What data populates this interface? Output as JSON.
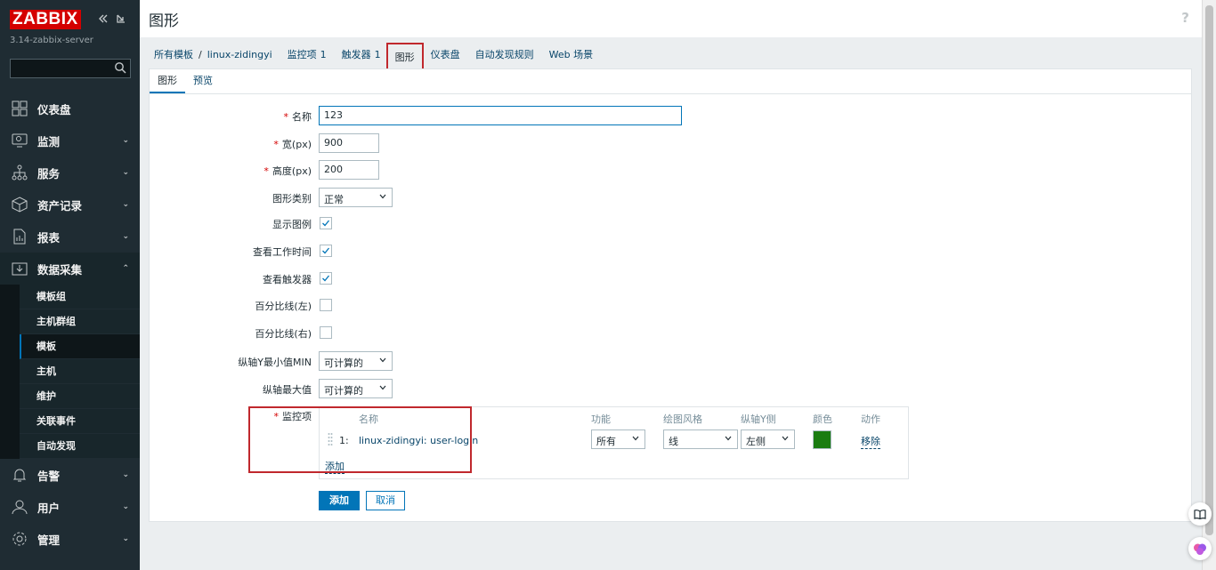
{
  "sidebar": {
    "logo": "ZABBIX",
    "server": "3.14-zabbix-server",
    "menu": [
      {
        "label": "仪表盘",
        "icon": "dashboard-icon"
      },
      {
        "label": "监测",
        "icon": "monitoring-icon"
      },
      {
        "label": "服务",
        "icon": "services-icon"
      },
      {
        "label": "资产记录",
        "icon": "inventory-icon"
      },
      {
        "label": "报表",
        "icon": "reports-icon"
      },
      {
        "label": "数据采集",
        "icon": "data-collection-icon"
      },
      {
        "label": "告警",
        "icon": "alerts-icon"
      },
      {
        "label": "用户",
        "icon": "users-icon"
      },
      {
        "label": "管理",
        "icon": "administration-icon"
      }
    ],
    "submenu": [
      "模板组",
      "主机群组",
      "模板",
      "主机",
      "维护",
      "关联事件",
      "自动发现"
    ]
  },
  "header": {
    "title": "图形",
    "help": "?"
  },
  "breadcrumb": {
    "all_templates": "所有模板",
    "separator": "/",
    "host": "linux-zidingyi",
    "items": "监控项",
    "items_count": "1",
    "triggers": "触发器",
    "triggers_count": "1",
    "graphs": "图形",
    "dashboards": "仪表盘",
    "discovery": "自动发现规则",
    "web": "Web 场景"
  },
  "tabs": {
    "graph": "图形",
    "preview": "预览"
  },
  "form": {
    "name_label": "名称",
    "name_value": "123",
    "width_label": "宽(px)",
    "width_value": "900",
    "height_label": "高度(px)",
    "height_value": "200",
    "type_label": "图形类别",
    "type_value": "正常",
    "legend_label": "显示图例",
    "legend_checked": true,
    "worktime_label": "查看工作时间",
    "worktime_checked": true,
    "triggers_label": "查看触发器",
    "triggers_checked": true,
    "percentile_left_label": "百分比线(左)",
    "percentile_left_checked": false,
    "percentile_right_label": "百分比线(右)",
    "percentile_right_checked": false,
    "ymin_label": "纵轴Y最小值MIN",
    "ymin_value": "可计算的",
    "ymax_label": "纵轴最大值",
    "ymax_value": "可计算的",
    "items_label": "监控项"
  },
  "items_table": {
    "headers": {
      "name": "名称",
      "function": "功能",
      "drawstyle": "绘图风格",
      "yaxis": "纵轴Y侧",
      "color": "颜色",
      "action": "动作"
    },
    "rows": [
      {
        "index": "1:",
        "name": "linux-zidingyi: user-login",
        "function": "所有",
        "drawstyle": "线",
        "yaxis": "左侧",
        "color": "#1A7C11",
        "action": "移除"
      }
    ],
    "add_link": "添加"
  },
  "buttons": {
    "add": "添加",
    "cancel": "取消"
  },
  "colors": {
    "accent": "#0275b8",
    "highlight": "#c0282d",
    "sidebar": "#1f2c33"
  }
}
